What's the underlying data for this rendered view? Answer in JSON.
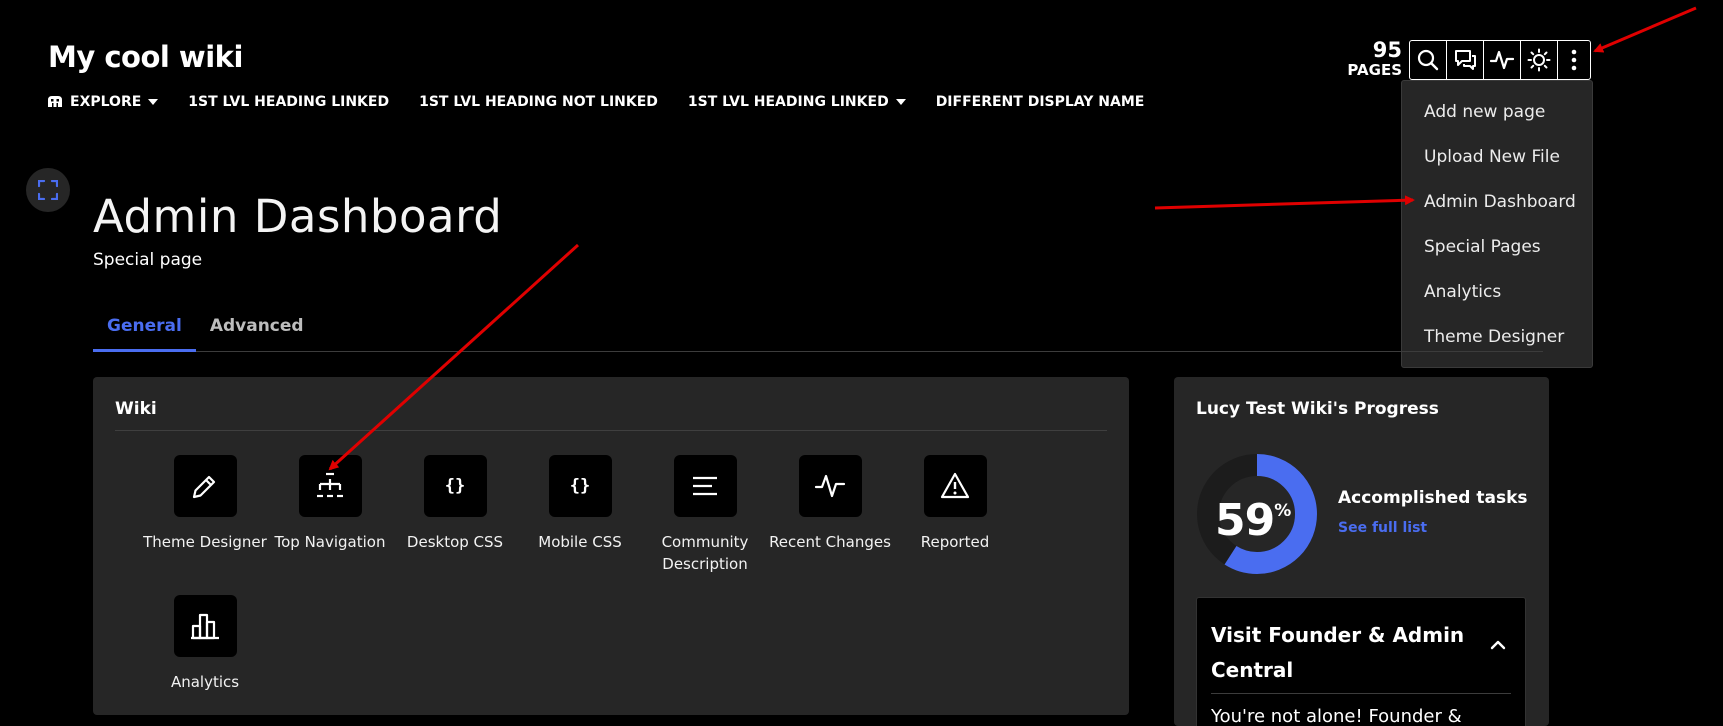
{
  "wiki": {
    "name": "My cool wiki"
  },
  "topnav": {
    "explore": "EXPLORE",
    "items": [
      "1ST LVL HEADING LINKED",
      "1ST LVL HEADING NOT LINKED",
      "1ST LVL HEADING LINKED",
      "DIFFERENT DISPLAY NAME"
    ]
  },
  "page_count": {
    "number": "95",
    "label": "PAGES"
  },
  "toolbar": {
    "icons": [
      "search-icon",
      "discussions-icon",
      "activity-icon",
      "theme-toggle-icon",
      "more-options-icon"
    ]
  },
  "more_menu": {
    "items": [
      "Add new page",
      "Upload New File",
      "Admin Dashboard",
      "Special Pages",
      "Analytics",
      "Theme Designer"
    ]
  },
  "page": {
    "title": "Admin Dashboard",
    "subtitle": "Special page"
  },
  "tabs": {
    "general": "General",
    "advanced": "Advanced",
    "active": "General"
  },
  "wiki_card": {
    "title": "Wiki",
    "tools": [
      {
        "label": "Theme Designer",
        "icon": "pencil-icon"
      },
      {
        "label": "Top Navigation",
        "icon": "sitemap-icon"
      },
      {
        "label": "Desktop CSS",
        "icon": "{}"
      },
      {
        "label": "Mobile CSS",
        "icon": "{}"
      },
      {
        "label": "Community Description",
        "icon": "text-lines-icon"
      },
      {
        "label": "Recent Changes",
        "icon": "activity-icon"
      },
      {
        "label": "Reported",
        "icon": "warning-icon"
      },
      {
        "label": "Analytics",
        "icon": "bar-chart-icon"
      }
    ]
  },
  "progress_card": {
    "title": "Lucy Test Wiki's Progress",
    "percent": "59",
    "percent_symbol": "%",
    "progress_fraction": 0.59,
    "accomplished": "Accomplished tasks",
    "see_full_list": "See full list",
    "founder_title": "Visit Founder & Admin Central",
    "founder_text": "You're not alone! Founder &"
  },
  "colors": {
    "accent": "#4a6df0",
    "background": "#000000",
    "card": "#262626",
    "annotation_arrow": "#e00000"
  }
}
